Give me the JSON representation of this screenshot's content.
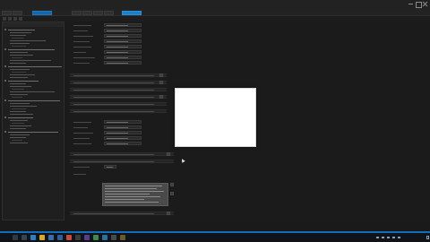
{
  "window": {
    "title": ""
  },
  "tabs": [
    {
      "label": "",
      "state": "inactive"
    },
    {
      "label": "",
      "state": "inactive"
    },
    {
      "label": "",
      "state": "blue"
    },
    {
      "label": "",
      "state": "inactive"
    },
    {
      "label": "",
      "state": "inactive"
    },
    {
      "label": "",
      "state": "inactive"
    },
    {
      "label": "",
      "state": "inactive"
    },
    {
      "label": "",
      "state": "active"
    }
  ],
  "statusbar": {
    "text": ""
  },
  "taskbar": {
    "clock_time": "",
    "clock_date": "",
    "icons": [
      "start-icon",
      "search-icon",
      "task-view-icon",
      "edge-icon",
      "explorer-icon",
      "store-icon",
      "mail-icon",
      "chrome-icon",
      "terminal-icon",
      "app-icon",
      "app-icon",
      "app-icon",
      "app-icon"
    ]
  },
  "colors": {
    "accent": "#1e7fc7",
    "editor_bg": "#1b1b1b",
    "statusbar": "#0f6fbe",
    "dialog_bg": "#ffffff"
  }
}
